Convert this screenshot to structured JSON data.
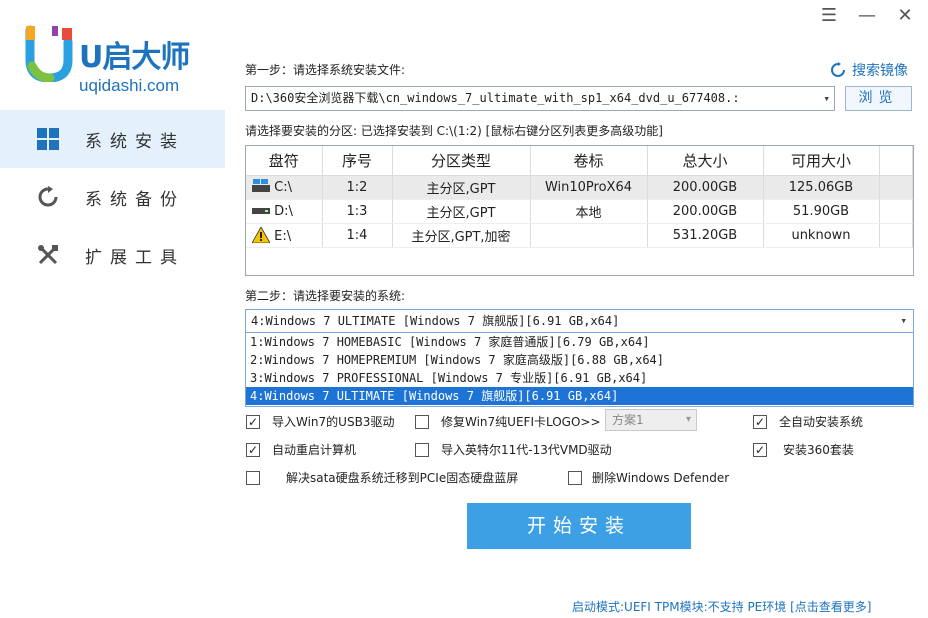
{
  "window": {
    "minimize": "—",
    "menu": "☰",
    "close": "✕"
  },
  "sidebar": {
    "logo_title": "U启大师",
    "logo_url": "uqidashi.com",
    "items": [
      {
        "label": "系统安装",
        "icon": "windows-icon",
        "active": true
      },
      {
        "label": "系统备份",
        "icon": "refresh-icon",
        "active": false
      },
      {
        "label": "扩展工具",
        "icon": "tools-icon",
        "active": false
      }
    ]
  },
  "step1": {
    "label": "第一步：请选择系统安装文件:",
    "search_mirror": "搜索镜像",
    "path": "D:\\360安全浏览器下载\\cn_windows_7_ultimate_with_sp1_x64_dvd_u_677408.:",
    "browse": "浏览"
  },
  "partition": {
    "label": "请选择要安装的分区: 已选择安装到 C:\\(1:2) [鼠标右键分区列表更多高级功能]",
    "headers": [
      "盘符",
      "序号",
      "分区类型",
      "卷标",
      "总大小",
      "可用大小"
    ],
    "rows": [
      {
        "drive": "C:\\",
        "icon": "windows-drive-icon",
        "index": "1:2",
        "type": "主分区,GPT",
        "volume": "Win10ProX64",
        "total": "200.00GB",
        "free": "125.06GB",
        "selected": true
      },
      {
        "drive": "D:\\",
        "icon": "drive-icon",
        "index": "1:3",
        "type": "主分区,GPT",
        "volume": "本地",
        "total": "200.00GB",
        "free": "51.90GB",
        "selected": false
      },
      {
        "drive": "E:\\",
        "icon": "warning-icon",
        "index": "1:4",
        "type": "主分区,GPT,加密",
        "volume": "",
        "total": "531.20GB",
        "free": "unknown",
        "selected": false
      }
    ]
  },
  "step2": {
    "label": "第二步：请选择要安装的系统:",
    "selected": "4:Windows 7 ULTIMATE [Windows 7 旗舰版][6.91 GB,x64]",
    "options": [
      "1:Windows 7 HOMEBASIC [Windows 7 家庭普通版][6.79 GB,x64]",
      "2:Windows 7 HOMEPREMIUM [Windows 7 家庭高级版][6.88 GB,x64]",
      "3:Windows 7 PROFESSIONAL [Windows 7 专业版][6.91 GB,x64]",
      "4:Windows 7 ULTIMATE [Windows 7 旗舰版][6.91 GB,x64]"
    ]
  },
  "options": {
    "usb3": {
      "label": "导入Win7的USB3驱动",
      "checked": true
    },
    "uefi_logo": {
      "label": "修复Win7纯UEFI卡LOGO>>",
      "checked": false
    },
    "scheme": "方案1",
    "auto_install": {
      "label": "全自动安装系统",
      "checked": true
    },
    "auto_restart": {
      "label": "自动重启计算机",
      "checked": true
    },
    "intel_vmd": {
      "label": "导入英特尔11代-13代VMD驱动",
      "checked": false
    },
    "install_360": {
      "label": "安装360套装",
      "checked": true
    },
    "sata_fix": {
      "label": "解决sata硬盘系统迁移到PCIe固态硬盘蓝屏",
      "checked": false
    },
    "remove_defender": {
      "label": "删除Windows Defender",
      "checked": false
    }
  },
  "start_button": "开始安装",
  "status_bar": "启动模式:UEFI TPM模块:不支持 PE环境 [点击查看更多]",
  "colors": {
    "accent": "#1e73be",
    "button": "#3da0e5",
    "selection": "#1e74d6"
  }
}
